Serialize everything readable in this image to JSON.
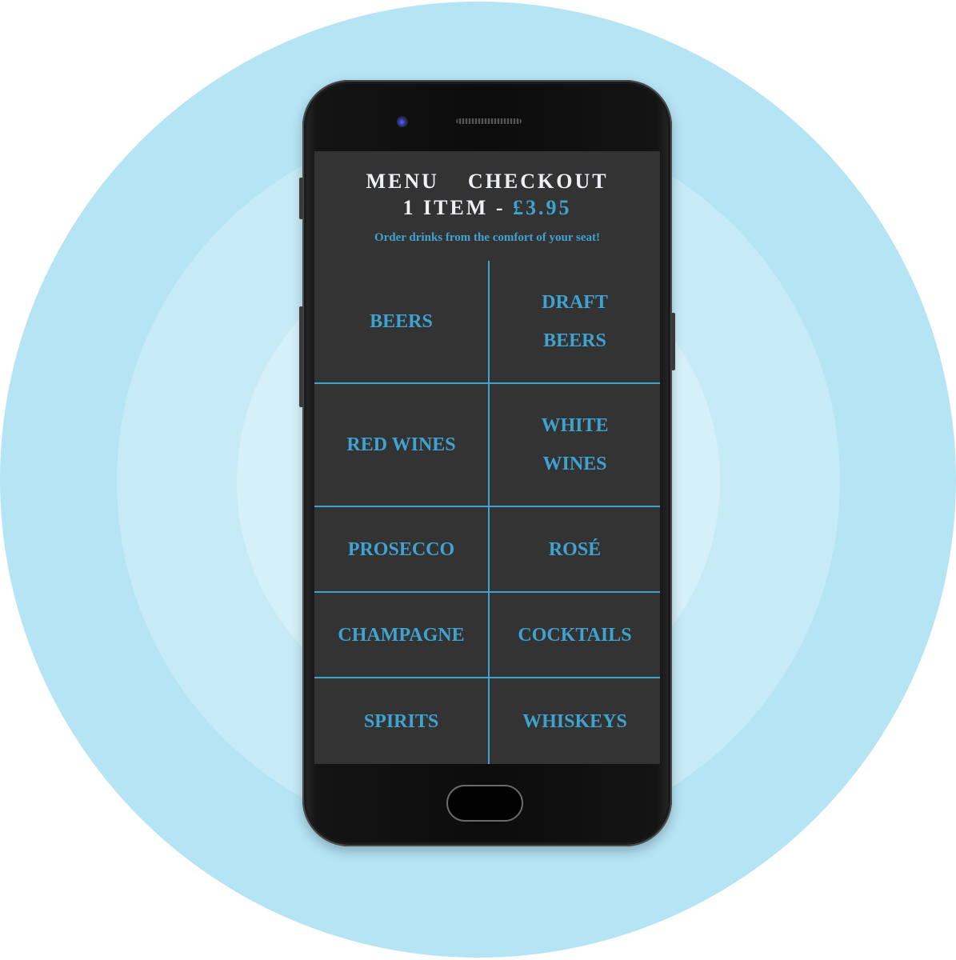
{
  "colors": {
    "accent": "#3fa3d1",
    "screen_background": "#333333",
    "header_text": "#eef0f4",
    "backdrop_outer": "#b5e4f5",
    "backdrop_mid": "#c7eaf7",
    "backdrop_inner": "#d6f0fa"
  },
  "header": {
    "nav": {
      "menu_label": "MENU",
      "checkout_label": "CHECKOUT"
    },
    "cart": {
      "count_text": "1 ITEM",
      "separator": "-",
      "total": "£3.95"
    },
    "tagline": "Order drinks from the comfort of your seat!"
  },
  "categories": [
    {
      "label": "BEERS"
    },
    {
      "label": "DRAFT BEERS"
    },
    {
      "label": "RED WINES"
    },
    {
      "label": "WHITE WINES"
    },
    {
      "label": "PROSECCO"
    },
    {
      "label": "ROSÉ"
    },
    {
      "label": "CHAMPAGNE"
    },
    {
      "label": "COCKTAILS"
    },
    {
      "label": "SPIRITS"
    },
    {
      "label": "WHISKEYS"
    }
  ],
  "device": {
    "icons": [
      "front-camera-icon",
      "earpiece-speaker-icon",
      "home-button-icon"
    ]
  }
}
